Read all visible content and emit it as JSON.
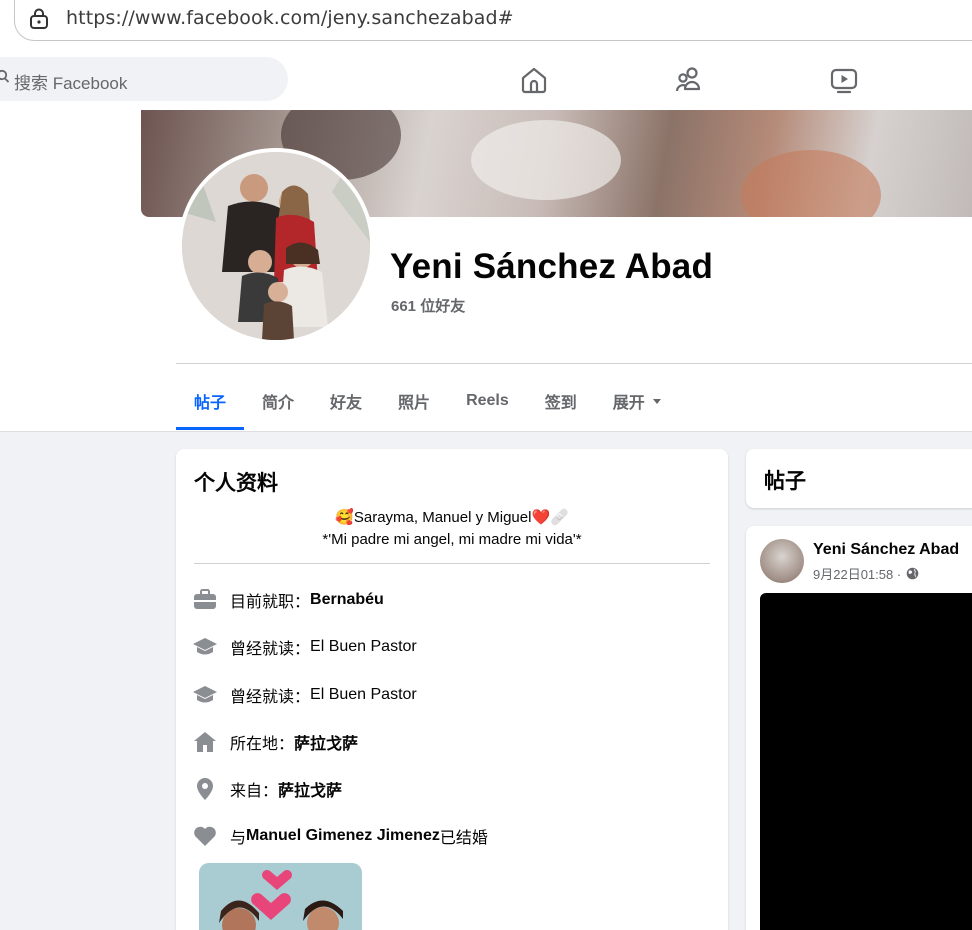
{
  "browser": {
    "url": "https://www.facebook.com/jeny.sanchezabad#"
  },
  "header": {
    "search_placeholder": "搜索 Facebook"
  },
  "profile": {
    "name": "Yeni Sánchez Abad",
    "friends": "661 位好友"
  },
  "tabs": [
    {
      "label": "帖子",
      "active": true
    },
    {
      "label": "简介"
    },
    {
      "label": "好友"
    },
    {
      "label": "照片"
    },
    {
      "label": "Reels"
    },
    {
      "label": "签到"
    },
    {
      "label": "展开"
    }
  ],
  "intro": {
    "title": "个人资料",
    "bio_line1": "🥰Sarayma, Manuel y Miguel❤️🩹",
    "bio_line2": "*'Mi padre mi angel, mi madre mi vida'*",
    "work_prefix": "目前就职：",
    "work_value": "Bernabéu",
    "edu1_prefix": "曾经就读：",
    "edu1_value": "El Buen Pastor",
    "edu2_prefix": "曾经就读：",
    "edu2_value": "El Buen Pastor",
    "lives_prefix": "所在地：",
    "lives_value": "萨拉戈萨",
    "from_prefix": "来自：",
    "from_value": "萨拉戈萨",
    "rel_prefix": "与 ",
    "rel_name": "Manuel Gimenez Jimenez",
    "rel_suffix": " 已结婚"
  },
  "posts": {
    "title": "帖子",
    "author": "Yeni Sánchez Abad",
    "time": "9月22日01:58 · "
  },
  "colors": {
    "accent": "#0866ff",
    "secondary_text": "#65676b",
    "icon_gray": "#8a8d91"
  }
}
